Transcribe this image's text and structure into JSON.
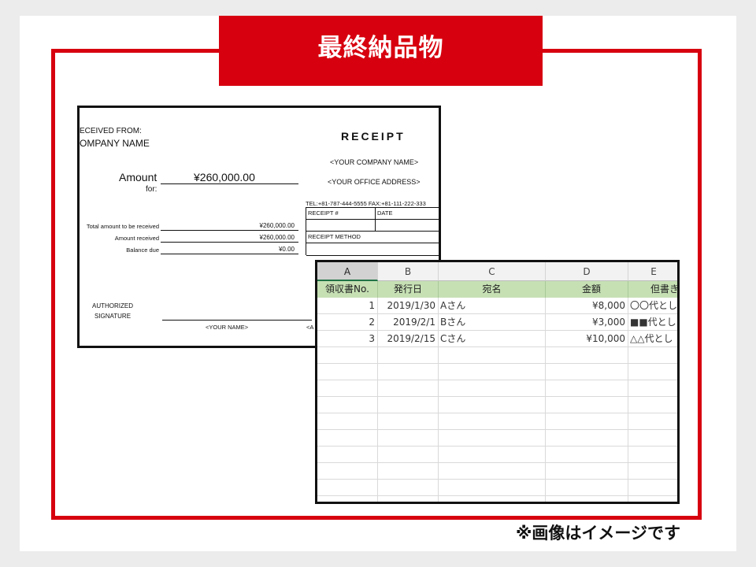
{
  "banner": {
    "title": "最終納品物"
  },
  "note": "※画像はイメージです",
  "receipt": {
    "received_from": "ECEIVED FROM:",
    "company_name": "OMPANY NAME",
    "title": "RECEIPT",
    "your_company": "<YOUR COMPANY NAME>",
    "your_address": "<YOUR OFFICE ADDRESS>",
    "tel_fax": "TEL:+81-787-444-5555  FAX:+81-111-222-333",
    "amount_label": "Amount",
    "for_label": "for:",
    "amount_value": "¥260,000.00",
    "rows": [
      {
        "label": "Total amount to be received",
        "value": "¥260,000.00"
      },
      {
        "label": "Amount received",
        "value": "¥260,000.00"
      },
      {
        "label": "Balance due",
        "value": "¥0.00"
      }
    ],
    "table": {
      "receipt_no": "RECEIPT #",
      "date": "DATE",
      "method": "RECEIPT METHOD"
    },
    "authorized_line1": "AUTHORIZED",
    "authorized_line2": "SIGNATURE",
    "your_name": "<YOUR NAME>",
    "extra": "<A"
  },
  "sheet": {
    "columns": [
      "A",
      "B",
      "C",
      "D",
      "E"
    ],
    "headers": [
      "領収書No.",
      "発行日",
      "宛名",
      "金額",
      "但書き"
    ],
    "rows": [
      {
        "no": "1",
        "date": "2019/1/30",
        "name": "Aさん",
        "amount": "¥8,000",
        "memo": "〇〇代とし"
      },
      {
        "no": "2",
        "date": "2019/2/1",
        "name": "Bさん",
        "amount": "¥3,000",
        "memo": "■■代とし"
      },
      {
        "no": "3",
        "date": "2019/2/15",
        "name": "Cさん",
        "amount": "¥10,000",
        "memo": "△△代とし"
      }
    ],
    "accent_color": "#217346",
    "header_fill": "#c6e0b4"
  },
  "colors": {
    "brand_red": "#d7000f"
  }
}
